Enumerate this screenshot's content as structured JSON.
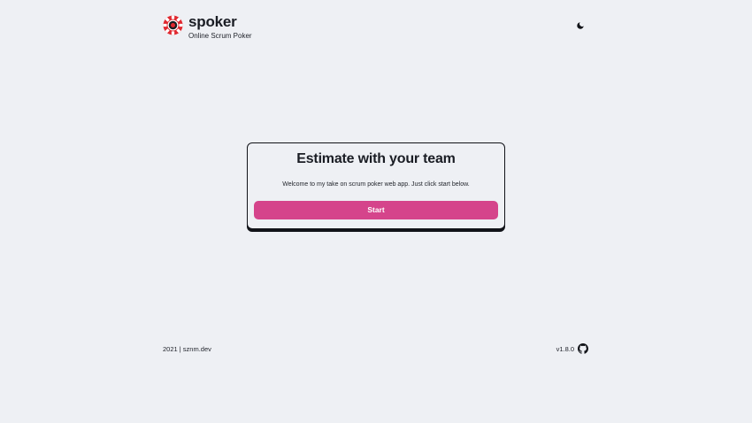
{
  "header": {
    "brand_name": "spoker",
    "tagline": "Online Scrum Poker",
    "logo_icon": "poker-chip-icon",
    "theme_toggle_icon": "moon-icon"
  },
  "card": {
    "title": "Estimate with your team",
    "description": "Welcome to my take on scrum poker web app. Just click start below.",
    "start_label": "Start"
  },
  "footer": {
    "copyright": "2021 | sznm.dev",
    "version": "v1.8.0",
    "repo_icon": "github-icon"
  },
  "colors": {
    "background": "#eef0f4",
    "accent": "#d5448b",
    "logo_red": "#e0282f",
    "text": "#1a1d24"
  }
}
